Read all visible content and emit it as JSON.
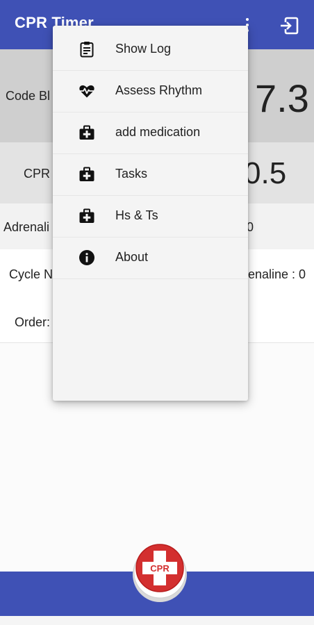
{
  "appbar": {
    "title": "CPR Timer",
    "overflow_icon": "more-vert-icon",
    "exit_icon": "exit-icon",
    "color": "#3f51b5"
  },
  "rows": {
    "code_blue": {
      "label": "Code Bl",
      "value": "7.3"
    },
    "cpr": {
      "label": "CPR",
      "value": "0.5"
    },
    "adrenaline": {
      "label": "Adrenali",
      "value": "0"
    },
    "cycle": {
      "label": "Cycle N",
      "right": "enaline : 0"
    },
    "order": {
      "label": "Order:"
    }
  },
  "menu": {
    "items": [
      {
        "label": "Show Log",
        "icon": "clipboard-icon"
      },
      {
        "label": "Assess Rhythm",
        "icon": "heart-pulse-icon"
      },
      {
        "label": "add medication",
        "icon": "medical-bag-icon"
      },
      {
        "label": "Tasks",
        "icon": "medical-bag-icon"
      },
      {
        "label": "Hs & Ts",
        "icon": "medical-bag-icon"
      },
      {
        "label": "About",
        "icon": "info-icon"
      }
    ]
  },
  "fab": {
    "label": "CPR",
    "icon": "cpr-cross-icon",
    "color": "#d32f2f"
  },
  "bottombar": {
    "color": "#3f51b5"
  }
}
